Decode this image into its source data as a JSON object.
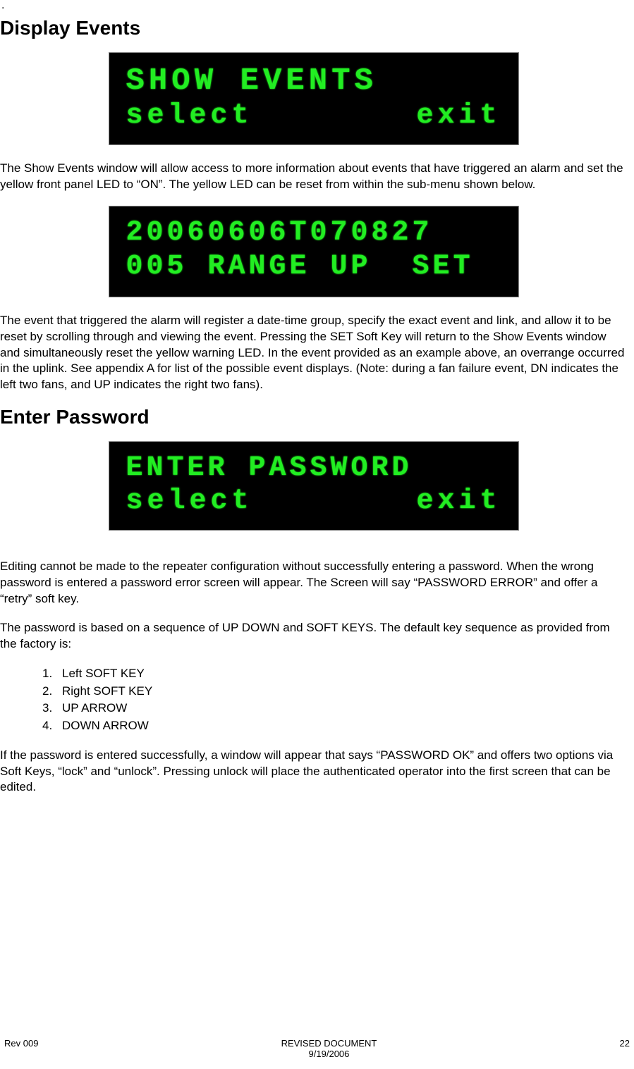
{
  "top_marker": ".",
  "sections": {
    "display_events": {
      "heading": "Display Events",
      "lcd1": {
        "line1": "SHOW EVENTS",
        "row2_left": "select",
        "row2_right": "exit"
      },
      "p1": "The Show Events window will allow access to more information about events that have triggered an alarm and set the yellow front panel LED to “ON”.  The yellow LED can be reset from within the sub-menu shown below.",
      "lcd2": {
        "line1": "20060606T070827",
        "line2": "005 RANGE UP  SET"
      },
      "p2": "The event that triggered the alarm will register a date-time group, specify the exact event and link, and allow it to be reset by scrolling through and viewing the event.  Pressing the SET Soft Key will return to the Show Events window and simultaneously reset the yellow warning LED.  In the event provided as an example above, an overrange occurred in the uplink.  See appendix A for list of the possible event displays. (Note: during a fan failure event, DN indicates the left two fans, and UP indicates the right two fans)."
    },
    "enter_password": {
      "heading": "Enter Password",
      "lcd": {
        "line1": "ENTER PASSWORD",
        "row2_left": "select",
        "row2_right": "exit"
      },
      "p1": "Editing cannot be made to the repeater configuration without successfully entering a password.  When the wrong password is entered a password error screen will appear.  The Screen will say “PASSWORD ERROR” and offer a “retry” soft key.",
      "p2": "The password is based on a sequence of UP DOWN and SOFT KEYS.  The default key sequence as provided from the factory is:",
      "list": [
        "Left SOFT KEY",
        "Right SOFT KEY",
        "UP ARROW",
        "DOWN ARROW"
      ],
      "p3": "If the password is entered successfully, a window will appear that says “PASSWORD OK” and offers two options via Soft Keys, “lock” and “unlock”.  Pressing unlock will place the authenticated operator into the first screen that can be edited."
    }
  },
  "footer": {
    "left": "Rev 009",
    "center_line1": "REVISED DOCUMENT",
    "center_line2": "9/19/2006",
    "right": "22"
  }
}
